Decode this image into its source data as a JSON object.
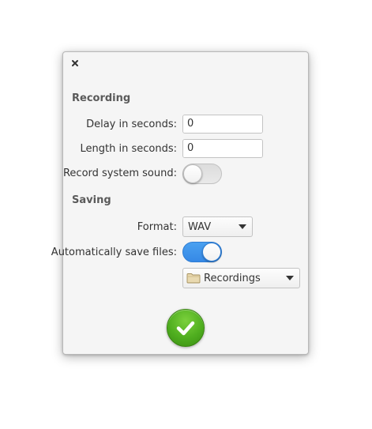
{
  "window": {
    "close_icon": "close-icon"
  },
  "recording": {
    "section_title": "Recording",
    "delay": {
      "label": "Delay in seconds:",
      "value": "0",
      "decrement_icon": "minus-icon",
      "increment_icon": "plus-icon"
    },
    "length": {
      "label": "Length in seconds:",
      "value": "0",
      "decrement_icon": "minus-icon",
      "increment_icon": "plus-icon"
    },
    "system_sound": {
      "label": "Record system sound:",
      "enabled": false
    }
  },
  "saving": {
    "section_title": "Saving",
    "format": {
      "label": "Format:",
      "selected": "WAV"
    },
    "auto_save": {
      "label": "Automatically save files:",
      "enabled": true
    },
    "folder": {
      "selected": "Recordings",
      "icon": "folder-icon"
    }
  },
  "apply_button": {
    "icon": "checkmark-icon"
  },
  "colors": {
    "dialog_bg": "#f5f5f5",
    "switch_on": "#3689e6",
    "apply_green": "#4fae1f"
  }
}
